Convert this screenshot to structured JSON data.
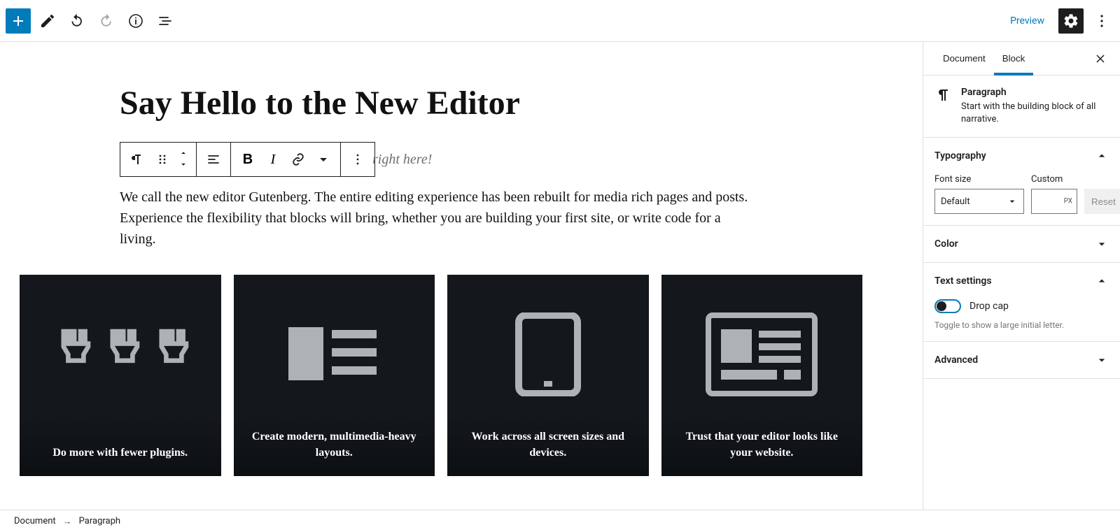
{
  "toolbar": {
    "preview_label": "Preview"
  },
  "document": {
    "title": "Say Hello to the New Editor",
    "hint_fragment": "right here!",
    "body_paragraph": "We call the new editor Gutenberg. The entire editing experience has been rebuilt for media rich pages and posts. Experience the flexibility that blocks will bring, whether you are building your first site, or write code for a living."
  },
  "cards": [
    {
      "caption": "Do more with fewer plugins."
    },
    {
      "caption": "Create modern, multimedia-heavy layouts."
    },
    {
      "caption": "Work across all screen sizes and devices."
    },
    {
      "caption": "Trust that your editor looks like your website."
    }
  ],
  "sidebar": {
    "tabs": {
      "document": "Document",
      "block": "Block"
    },
    "block_info": {
      "title": "Paragraph",
      "desc": "Start with the building block of all narrative."
    },
    "typography": {
      "title": "Typography",
      "font_size_label": "Font size",
      "custom_label": "Custom",
      "default_option": "Default",
      "unit": "PX",
      "reset": "Reset"
    },
    "color": {
      "title": "Color"
    },
    "text_settings": {
      "title": "Text settings",
      "drop_cap_label": "Drop cap",
      "drop_cap_help": "Toggle to show a large initial letter."
    },
    "advanced": {
      "title": "Advanced"
    }
  },
  "breadcrumb": {
    "document": "Document",
    "current": "Paragraph"
  }
}
